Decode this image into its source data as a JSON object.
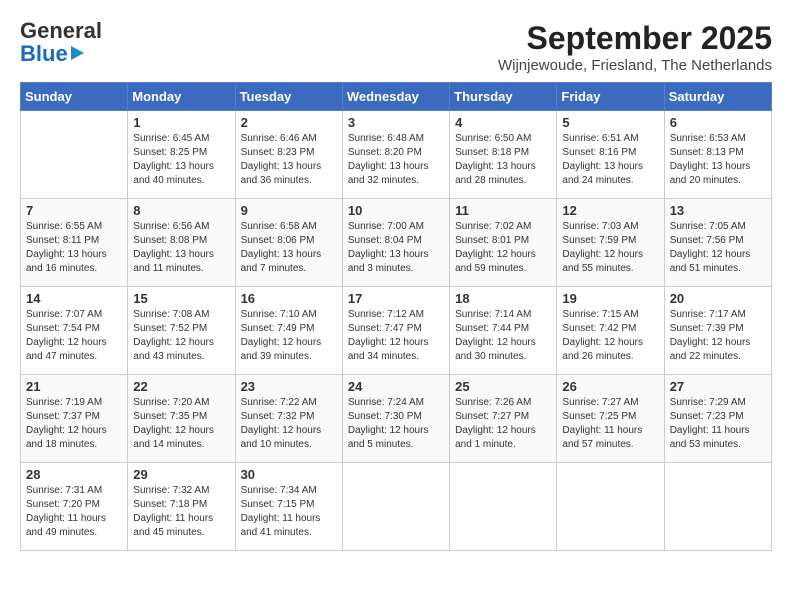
{
  "header": {
    "logo_line1": "General",
    "logo_line2": "Blue",
    "month": "September 2025",
    "location": "Wijnjewoude, Friesland, The Netherlands"
  },
  "days_of_week": [
    "Sunday",
    "Monday",
    "Tuesday",
    "Wednesday",
    "Thursday",
    "Friday",
    "Saturday"
  ],
  "weeks": [
    [
      {
        "day": "",
        "info": ""
      },
      {
        "day": "1",
        "info": "Sunrise: 6:45 AM\nSunset: 8:25 PM\nDaylight: 13 hours\nand 40 minutes."
      },
      {
        "day": "2",
        "info": "Sunrise: 6:46 AM\nSunset: 8:23 PM\nDaylight: 13 hours\nand 36 minutes."
      },
      {
        "day": "3",
        "info": "Sunrise: 6:48 AM\nSunset: 8:20 PM\nDaylight: 13 hours\nand 32 minutes."
      },
      {
        "day": "4",
        "info": "Sunrise: 6:50 AM\nSunset: 8:18 PM\nDaylight: 13 hours\nand 28 minutes."
      },
      {
        "day": "5",
        "info": "Sunrise: 6:51 AM\nSunset: 8:16 PM\nDaylight: 13 hours\nand 24 minutes."
      },
      {
        "day": "6",
        "info": "Sunrise: 6:53 AM\nSunset: 8:13 PM\nDaylight: 13 hours\nand 20 minutes."
      }
    ],
    [
      {
        "day": "7",
        "info": "Sunrise: 6:55 AM\nSunset: 8:11 PM\nDaylight: 13 hours\nand 16 minutes."
      },
      {
        "day": "8",
        "info": "Sunrise: 6:56 AM\nSunset: 8:08 PM\nDaylight: 13 hours\nand 11 minutes."
      },
      {
        "day": "9",
        "info": "Sunrise: 6:58 AM\nSunset: 8:06 PM\nDaylight: 13 hours\nand 7 minutes."
      },
      {
        "day": "10",
        "info": "Sunrise: 7:00 AM\nSunset: 8:04 PM\nDaylight: 13 hours\nand 3 minutes."
      },
      {
        "day": "11",
        "info": "Sunrise: 7:02 AM\nSunset: 8:01 PM\nDaylight: 12 hours\nand 59 minutes."
      },
      {
        "day": "12",
        "info": "Sunrise: 7:03 AM\nSunset: 7:59 PM\nDaylight: 12 hours\nand 55 minutes."
      },
      {
        "day": "13",
        "info": "Sunrise: 7:05 AM\nSunset: 7:56 PM\nDaylight: 12 hours\nand 51 minutes."
      }
    ],
    [
      {
        "day": "14",
        "info": "Sunrise: 7:07 AM\nSunset: 7:54 PM\nDaylight: 12 hours\nand 47 minutes."
      },
      {
        "day": "15",
        "info": "Sunrise: 7:08 AM\nSunset: 7:52 PM\nDaylight: 12 hours\nand 43 minutes."
      },
      {
        "day": "16",
        "info": "Sunrise: 7:10 AM\nSunset: 7:49 PM\nDaylight: 12 hours\nand 39 minutes."
      },
      {
        "day": "17",
        "info": "Sunrise: 7:12 AM\nSunset: 7:47 PM\nDaylight: 12 hours\nand 34 minutes."
      },
      {
        "day": "18",
        "info": "Sunrise: 7:14 AM\nSunset: 7:44 PM\nDaylight: 12 hours\nand 30 minutes."
      },
      {
        "day": "19",
        "info": "Sunrise: 7:15 AM\nSunset: 7:42 PM\nDaylight: 12 hours\nand 26 minutes."
      },
      {
        "day": "20",
        "info": "Sunrise: 7:17 AM\nSunset: 7:39 PM\nDaylight: 12 hours\nand 22 minutes."
      }
    ],
    [
      {
        "day": "21",
        "info": "Sunrise: 7:19 AM\nSunset: 7:37 PM\nDaylight: 12 hours\nand 18 minutes."
      },
      {
        "day": "22",
        "info": "Sunrise: 7:20 AM\nSunset: 7:35 PM\nDaylight: 12 hours\nand 14 minutes."
      },
      {
        "day": "23",
        "info": "Sunrise: 7:22 AM\nSunset: 7:32 PM\nDaylight: 12 hours\nand 10 minutes."
      },
      {
        "day": "24",
        "info": "Sunrise: 7:24 AM\nSunset: 7:30 PM\nDaylight: 12 hours\nand 5 minutes."
      },
      {
        "day": "25",
        "info": "Sunrise: 7:26 AM\nSunset: 7:27 PM\nDaylight: 12 hours\nand 1 minute."
      },
      {
        "day": "26",
        "info": "Sunrise: 7:27 AM\nSunset: 7:25 PM\nDaylight: 11 hours\nand 57 minutes."
      },
      {
        "day": "27",
        "info": "Sunrise: 7:29 AM\nSunset: 7:23 PM\nDaylight: 11 hours\nand 53 minutes."
      }
    ],
    [
      {
        "day": "28",
        "info": "Sunrise: 7:31 AM\nSunset: 7:20 PM\nDaylight: 11 hours\nand 49 minutes."
      },
      {
        "day": "29",
        "info": "Sunrise: 7:32 AM\nSunset: 7:18 PM\nDaylight: 11 hours\nand 45 minutes."
      },
      {
        "day": "30",
        "info": "Sunrise: 7:34 AM\nSunset: 7:15 PM\nDaylight: 11 hours\nand 41 minutes."
      },
      {
        "day": "",
        "info": ""
      },
      {
        "day": "",
        "info": ""
      },
      {
        "day": "",
        "info": ""
      },
      {
        "day": "",
        "info": ""
      }
    ]
  ]
}
